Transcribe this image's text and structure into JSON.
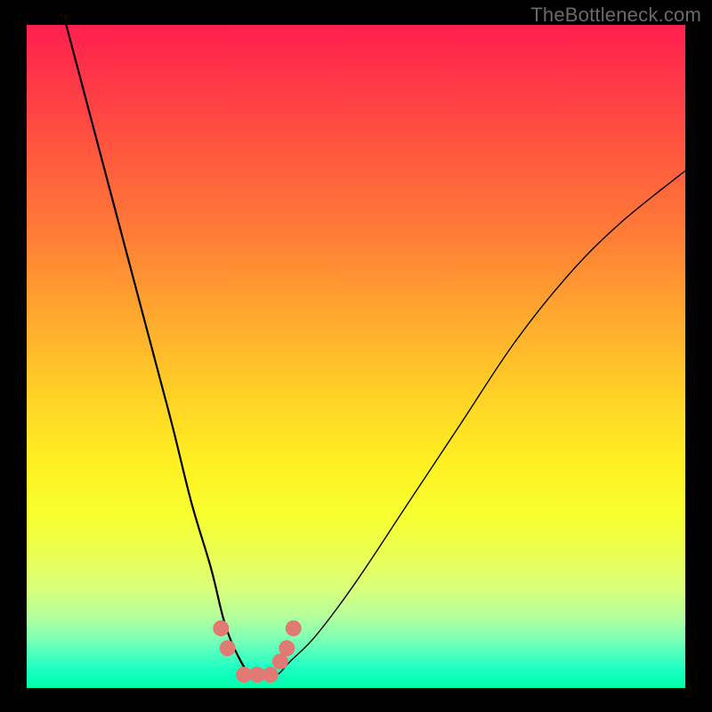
{
  "watermark": "TheBottleneck.com",
  "chart_data": {
    "type": "line",
    "title": "",
    "xlabel": "",
    "ylabel": "",
    "xlim": [
      0,
      100
    ],
    "ylim": [
      0,
      100
    ],
    "grid": false,
    "legend": false,
    "series": [
      {
        "name": "bottleneck-curve",
        "x": [
          6,
          10,
          14,
          18,
          22,
          25,
          28,
          30,
          32,
          34,
          36,
          38,
          40,
          44,
          50,
          58,
          66,
          74,
          82,
          90,
          100
        ],
        "values": [
          100,
          85,
          70,
          55,
          40,
          28,
          18,
          10,
          5,
          2,
          2,
          2,
          4,
          8,
          16,
          28,
          40,
          52,
          62,
          70,
          78
        ]
      }
    ],
    "markers": {
      "name": "highlight-points",
      "color": "#e07a73",
      "x": [
        29.5,
        30.5,
        33,
        35,
        37,
        38.5,
        39.5,
        40.5
      ],
      "values": [
        9,
        6,
        2,
        2,
        2,
        4,
        6,
        9
      ]
    },
    "gradient_stops": [
      {
        "pos": 0,
        "color": "#ff1f4f"
      },
      {
        "pos": 50,
        "color": "#ffd226"
      },
      {
        "pos": 74,
        "color": "#f8ff30"
      },
      {
        "pos": 100,
        "color": "#02ffa9"
      }
    ]
  }
}
